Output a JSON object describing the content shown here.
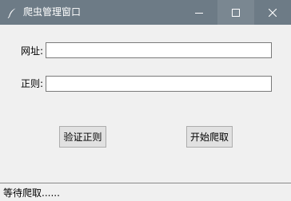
{
  "window": {
    "title": "爬虫管理窗口",
    "titlebar_color": "#6d7b86",
    "icon": "feather-icon"
  },
  "form": {
    "url_label": "网址:",
    "url_value": "",
    "regex_label": "正则:",
    "regex_value": ""
  },
  "buttons": {
    "verify_label": "验证正则",
    "start_label": "开始爬取"
  },
  "status": {
    "text": "等待爬取......"
  }
}
